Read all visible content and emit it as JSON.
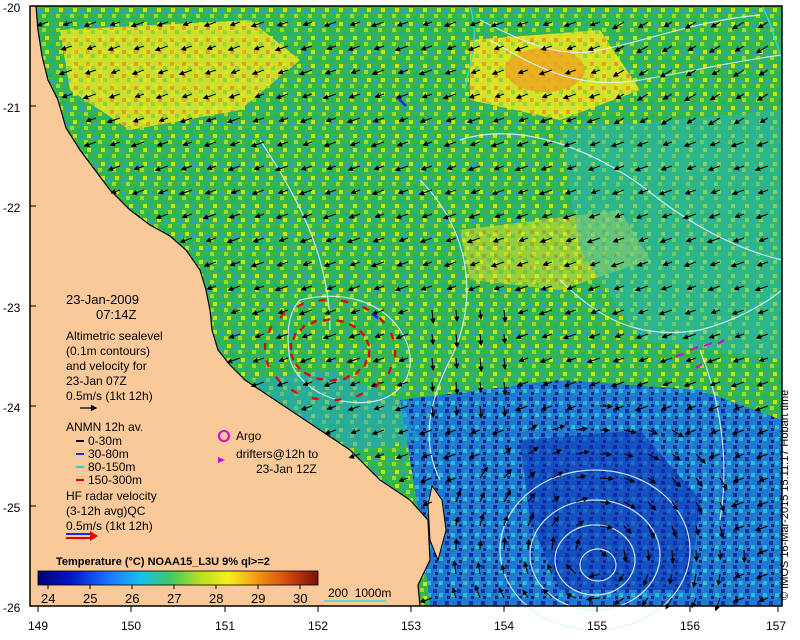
{
  "colors": {
    "land": "#f9c99a",
    "ocean_warm": "#2db34a",
    "cold_blue": "#1560d0",
    "contour": "#d8f3ff",
    "hf_red": "#e00000",
    "argo": "#d600d6"
  },
  "map": {
    "lat_ticks": [
      "-20",
      "-21",
      "-22",
      "-23",
      "-24",
      "-25",
      "-26"
    ],
    "lon_ticks": [
      "149",
      "150",
      "151",
      "152",
      "153",
      "154",
      "155",
      "156",
      "157"
    ]
  },
  "legend": {
    "date": "23-Jan-2009",
    "time": "07:14Z",
    "altimetric": [
      "Altimetric sealevel",
      "(0.1m contours)",
      "and velocity for",
      "23-Jan 07Z",
      "0.5m/s (1kt 12h)"
    ],
    "anmn_title": "ANMN 12h av.",
    "anmn_items": [
      {
        "label": "0-30m",
        "color": "#000000"
      },
      {
        "label": "30-80m",
        "color": "#1a24ff"
      },
      {
        "label": "80-150m",
        "color": "#00d8d8"
      },
      {
        "label": "150-300m",
        "color": "#e00000"
      }
    ],
    "argo": "Argo",
    "drifters": [
      "drifters@12h to",
      "23-Jan 12Z"
    ],
    "hf": [
      "HF radar velocity",
      "(3-12h avg)QC",
      "0.5m/s (1kt 12h)"
    ]
  },
  "colorbar": {
    "title": "Temperature (°C) NOAA15_L3U 9% ql>=2",
    "ticks": [
      "24",
      "25",
      "26",
      "27",
      "28",
      "29",
      "30"
    ],
    "colors": [
      "#00007a",
      "#0018c8",
      "#1a73ff",
      "#19c2ee",
      "#3ec864",
      "#b8e021",
      "#f5f01e",
      "#f59a12",
      "#cc4410",
      "#7a1008"
    ]
  },
  "depth_legend": "200  1000m",
  "credit": "© IMOS 16-Mar-2015 15:11:17 Hobart time"
}
